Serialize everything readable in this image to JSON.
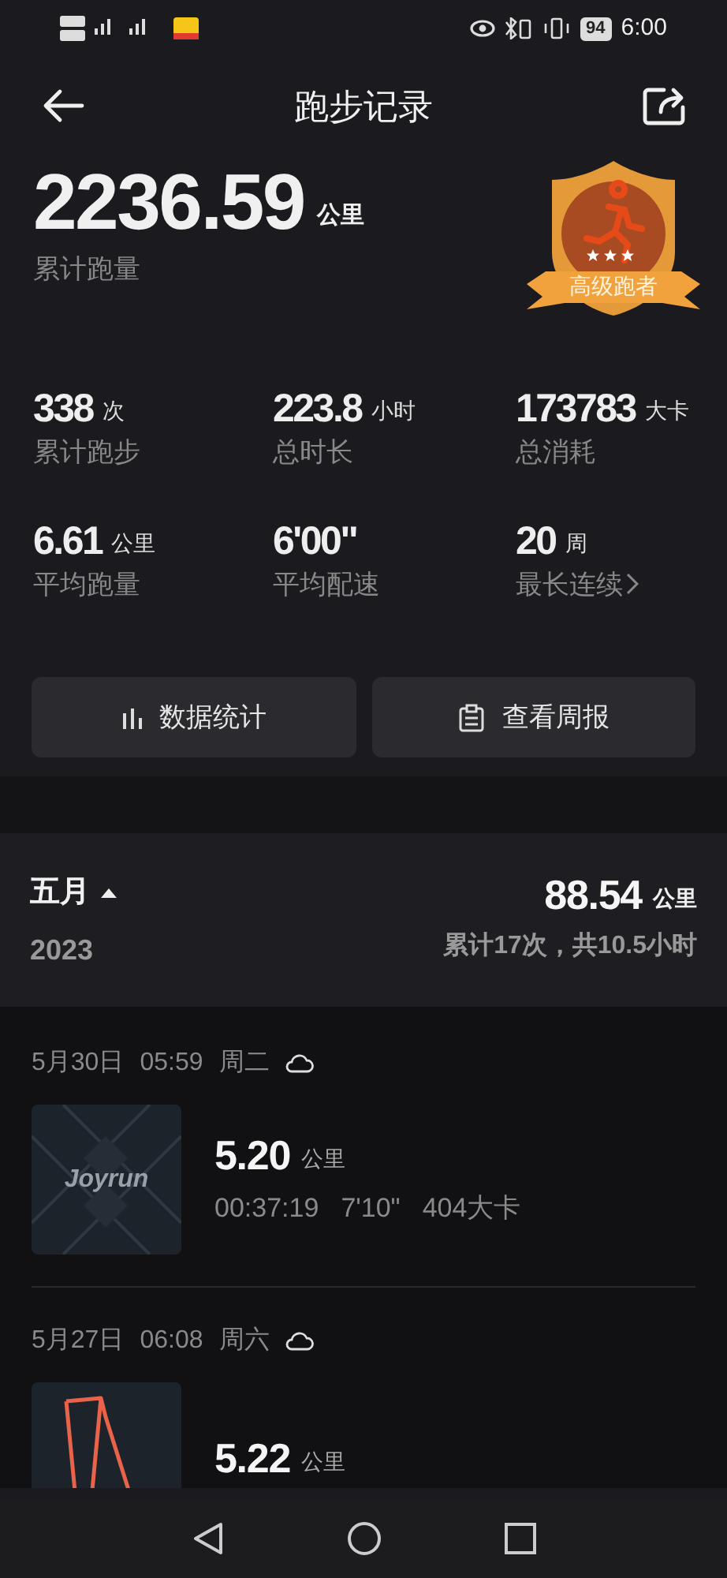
{
  "status_bar": {
    "battery": "94",
    "time": "6:00"
  },
  "header": {
    "title": "跑步记录"
  },
  "total": {
    "value": "2236.59",
    "unit": "公里",
    "label": "累计跑量",
    "badge": "高级跑者",
    "stars": 3
  },
  "stats": [
    {
      "kind": "plain",
      "value": "338",
      "unit": "次",
      "label": "累计跑步"
    },
    {
      "kind": "plain",
      "value": "223.8",
      "unit": "小时",
      "label": "总时长"
    },
    {
      "kind": "plain",
      "value": "173783",
      "unit": "大卡",
      "label": "总消耗"
    },
    {
      "kind": "plain",
      "value": "6.61",
      "unit": "公里",
      "label": "平均跑量"
    },
    {
      "kind": "plain",
      "value": "6'00\"",
      "label": "平均配速"
    },
    {
      "kind": "link",
      "value": "20",
      "unit": "周",
      "label": "最长连续"
    }
  ],
  "buttons": [
    {
      "kind": "chart",
      "label": "数据统计"
    },
    {
      "kind": "report",
      "label": "查看周报"
    }
  ],
  "month": {
    "name": "五月",
    "expanded": true,
    "year": "2023",
    "distance": "88.54",
    "unit": "公里",
    "summary": "累计17次，共10.5小时"
  },
  "runs": [
    {
      "date": "5月30日",
      "time": "05:59",
      "weekday": "周二",
      "kind": "logo",
      "thumbnail_text": "Joyrun",
      "distance": "5.20",
      "unit": "公里",
      "duration": "00:37:19",
      "pace": "7'10\"",
      "calories": "404大卡"
    },
    {
      "date": "5月27日",
      "time": "06:08",
      "weekday": "周六",
      "kind": "route",
      "distance": "5.22",
      "unit": "公里"
    }
  ]
}
